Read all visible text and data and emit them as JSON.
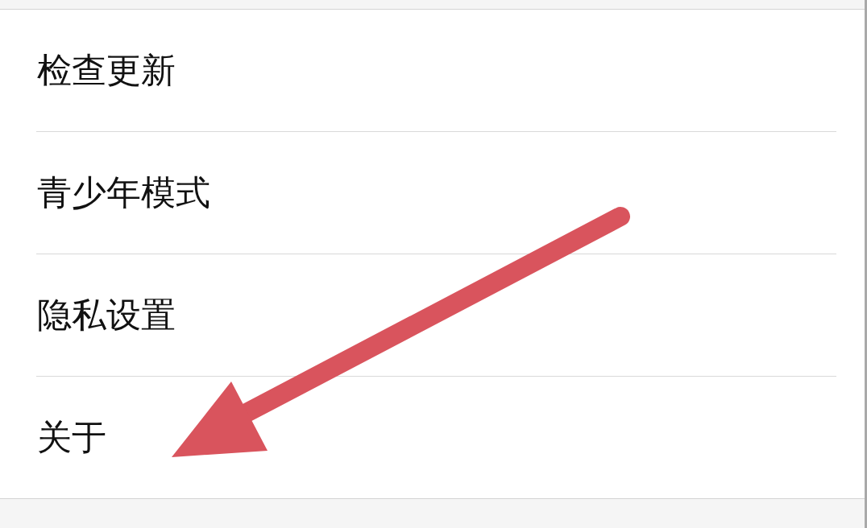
{
  "settings_menu": {
    "items": [
      {
        "label": "检查更新"
      },
      {
        "label": "青少年模式"
      },
      {
        "label": "隐私设置"
      },
      {
        "label": "关于"
      }
    ]
  }
}
